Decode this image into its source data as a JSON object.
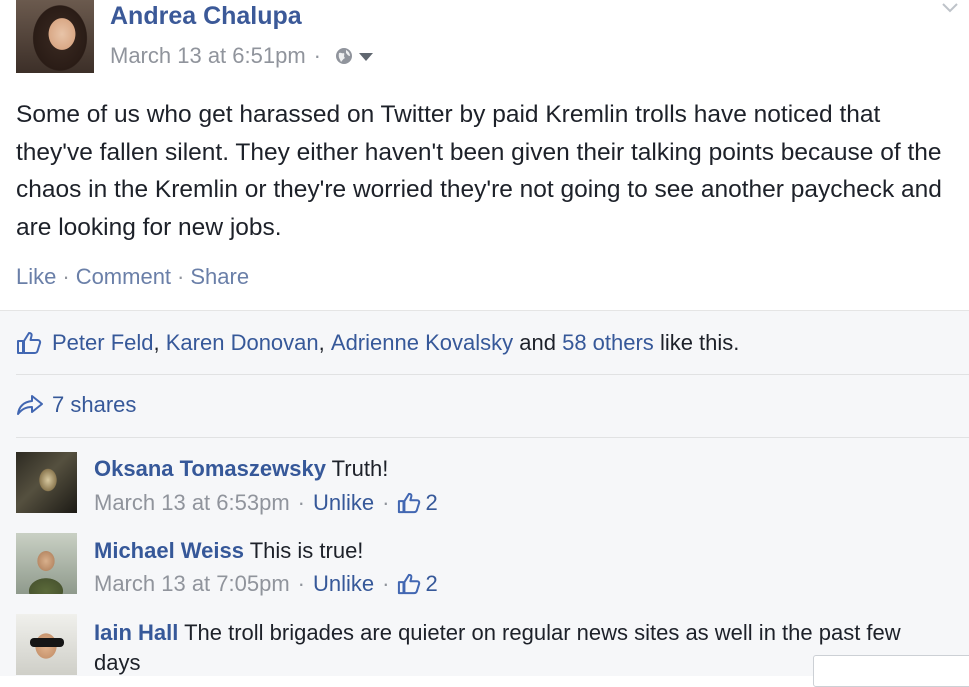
{
  "post": {
    "author": "Andrea Chalupa",
    "timestamp": "March 13 at 6:51pm",
    "meta_separator": "·",
    "audience_icon": "globe-icon",
    "text": "Some of us who get harassed on Twitter by paid Kremlin trolls have noticed that they've fallen silent. They either haven't been given their talking points because of the chaos in the Kremlin or they're worried they're not going to see another paycheck and are looking for new jobs."
  },
  "actions": {
    "like": "Like",
    "comment": "Comment",
    "share": "Share",
    "separator": "·"
  },
  "likes": {
    "names": [
      "Peter Feld",
      "Karen Donovan",
      "Adrienne Kovalsky"
    ],
    "comma": ",",
    "and_text": "and",
    "others_link": "58 others",
    "suffix": "like this."
  },
  "shares": {
    "label": "7 shares"
  },
  "comments": [
    {
      "name": "Oksana Tomaszewsky",
      "text": "Truth!",
      "timestamp": "March 13 at 6:53pm",
      "unlike": "Unlike",
      "like_count": "2"
    },
    {
      "name": "Michael Weiss",
      "text": "This is true!",
      "timestamp": "March 13 at 7:05pm",
      "unlike": "Unlike",
      "like_count": "2"
    },
    {
      "name": "Iain Hall",
      "text": "The troll brigades are quieter on regular news sites as well in the past few days"
    }
  ],
  "colors": {
    "link": "#365899",
    "name": "#3b5998",
    "meta": "#90949c",
    "ufi_background": "#f6f7f9"
  }
}
